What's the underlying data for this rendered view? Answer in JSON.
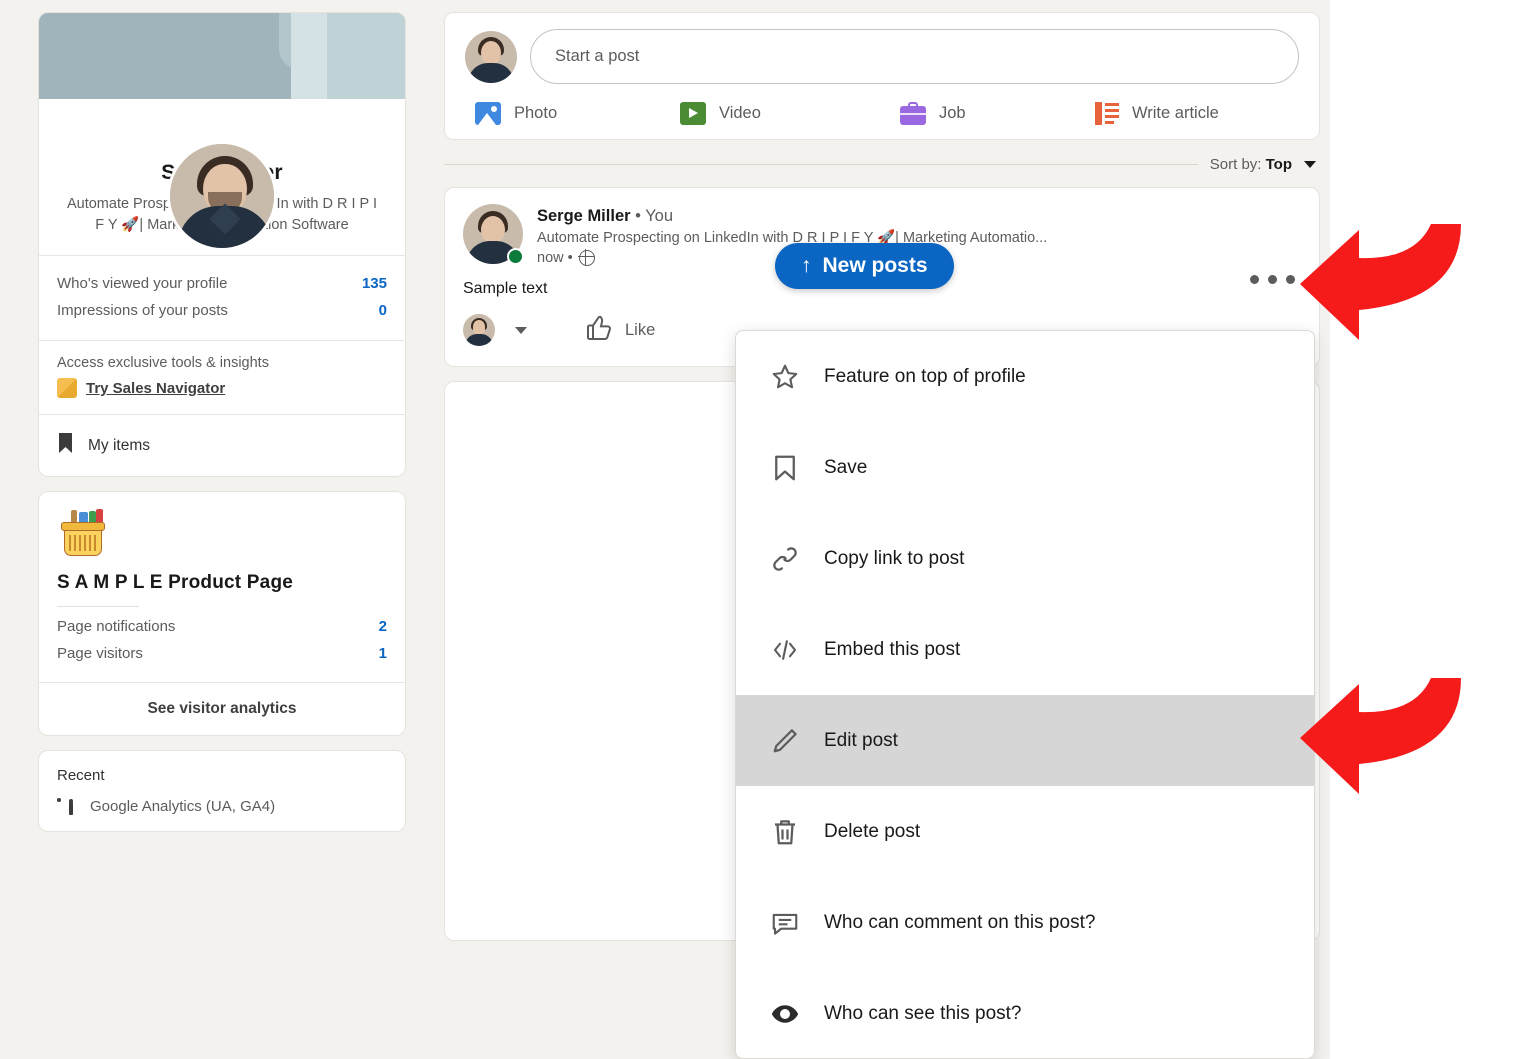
{
  "colors": {
    "brand_blue": "#0a66c2",
    "page_bg": "#f4f2ee",
    "card_bg": "#ffffff",
    "arrow_red": "#f51b1b",
    "highlight_gray": "#d6d6d6",
    "text_primary": "#191919",
    "text_secondary": "#5c5c5c",
    "online_green": "#0b7a3b"
  },
  "sidebar": {
    "profile": {
      "name": "Serge Miller",
      "headline": "Automate Prospecting on LinkedIn with D R I P I F Y 🚀| Marketing Automation Software",
      "avatar_name": "profile-avatar",
      "banner_name": "profile-banner",
      "stats": [
        {
          "label": "Who's viewed your profile",
          "value": "135"
        },
        {
          "label": "Impressions of your posts",
          "value": "0"
        }
      ],
      "promo": {
        "title": "Access exclusive tools & insights",
        "link": "Try Sales Navigator",
        "icon": "sales-navigator-icon"
      },
      "my_items": {
        "label": "My items",
        "icon": "bookmark-icon"
      }
    },
    "product_page": {
      "icon": "shopping-basket-icon",
      "name": "S A M P L E Product Page",
      "stats": [
        {
          "label": "Page notifications",
          "value": "2"
        },
        {
          "label": "Page visitors",
          "value": "1"
        }
      ],
      "cta": "See visitor analytics"
    },
    "recent": {
      "title": "Recent",
      "items": [
        {
          "label": "Google Analytics (UA, GA4)",
          "icon": "bar-chart-icon"
        }
      ]
    }
  },
  "composer": {
    "placeholder": "Start a post",
    "avatar_name": "composer-avatar",
    "actions": [
      {
        "label": "Photo",
        "icon": "photo-icon"
      },
      {
        "label": "Video",
        "icon": "video-icon"
      },
      {
        "label": "Job",
        "icon": "briefcase-icon"
      },
      {
        "label": "Write article",
        "icon": "article-icon"
      }
    ]
  },
  "feed": {
    "sort": {
      "prefix": "Sort by: ",
      "value": "Top",
      "icon": "chevron-down-icon"
    },
    "new_posts_pill": {
      "label": "New posts",
      "arrow": "↑",
      "icon": "arrow-up-icon"
    },
    "post": {
      "author": "Serge Miller",
      "author_suffix": " • You",
      "headline": "Automate Prospecting on LinkedIn with D R I P I F Y 🚀| Marketing Automatio...",
      "time": "now • ",
      "visibility_icon": "globe-icon",
      "body": "Sample text",
      "like_label": "Like",
      "like_icon": "thumbs-up-icon",
      "overflow_icon": "ellipsis-icon"
    }
  },
  "menu": {
    "items": [
      {
        "label": "Feature on top of profile",
        "icon": "star-icon",
        "active": false
      },
      {
        "label": "Save",
        "icon": "bookmark-icon",
        "active": false
      },
      {
        "label": "Copy link to post",
        "icon": "link-icon",
        "active": false
      },
      {
        "label": "Embed this post",
        "icon": "code-icon",
        "active": false
      },
      {
        "label": "Edit post",
        "icon": "pencil-icon",
        "active": true
      },
      {
        "label": "Delete post",
        "icon": "trash-icon",
        "active": false
      },
      {
        "label": "Who can comment on this post?",
        "icon": "comment-icon",
        "active": false
      },
      {
        "label": "Who can see this post?",
        "icon": "eye-icon",
        "active": false
      }
    ]
  },
  "annotations": {
    "arrows": [
      {
        "name": "arrow-pointing-to-overflow-menu",
        "target": "ellipsis-icon"
      },
      {
        "name": "arrow-pointing-to-edit-post",
        "target": "Edit post"
      }
    ]
  }
}
